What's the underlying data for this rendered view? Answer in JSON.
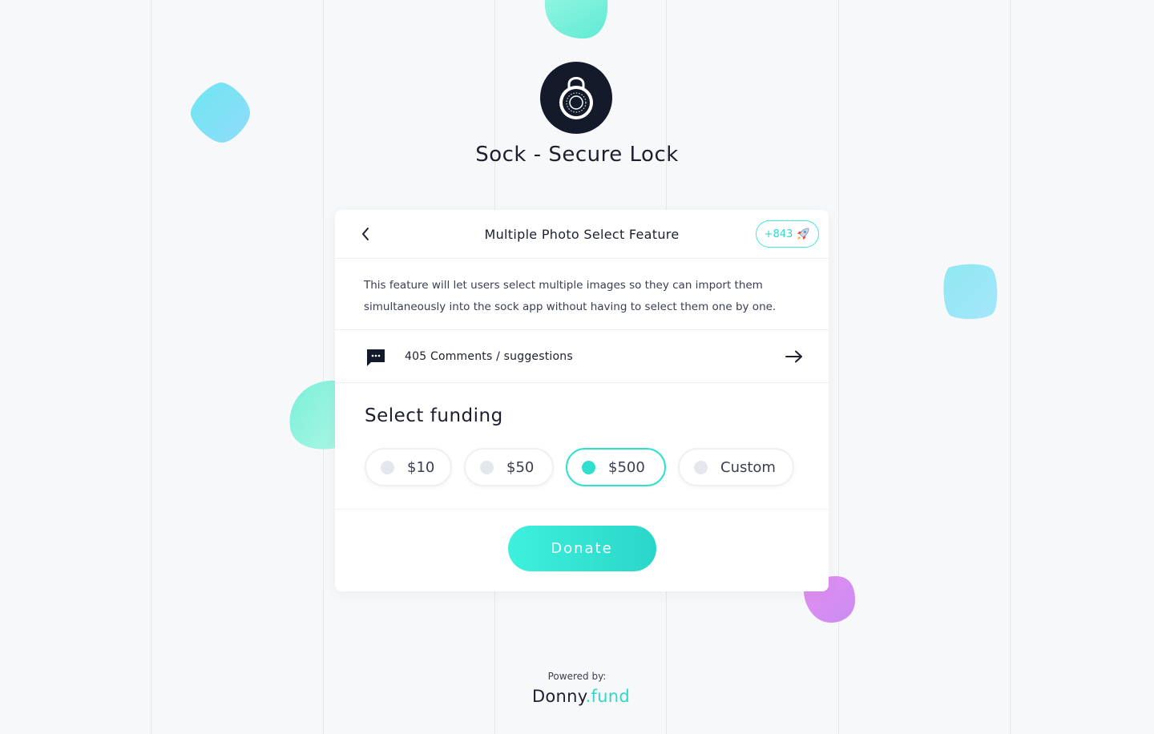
{
  "app": {
    "title": "Sock - Secure Lock",
    "logo_icon": "padlock-icon"
  },
  "feature": {
    "title": "Multiple Photo Select Feature",
    "votes": "+843",
    "votes_icon": "rocket-icon",
    "description": "This feature will let users select multiple images so they can import them simultaneously into the sock app without having to select them one by one."
  },
  "comments": {
    "label": "405 Comments / suggestions"
  },
  "funding": {
    "title": "Select funding",
    "options": [
      {
        "label": "$10",
        "selected": false
      },
      {
        "label": "$50",
        "selected": false
      },
      {
        "label": "$500",
        "selected": true
      },
      {
        "label": "Custom",
        "selected": false
      }
    ]
  },
  "donate": {
    "label": "Donate"
  },
  "footer": {
    "powered_label": "Powered by:",
    "brand_name": "Donny",
    "brand_suffix": ".fund"
  },
  "colors": {
    "accent": "#2fe0cf",
    "dark": "#151a2b",
    "page_bg": "#f7f8fa"
  }
}
